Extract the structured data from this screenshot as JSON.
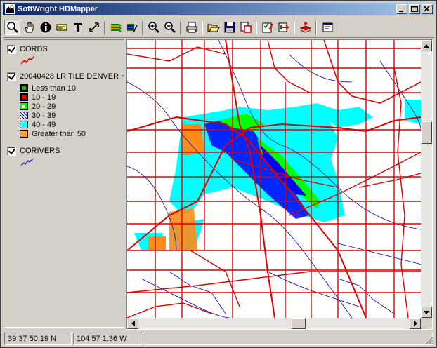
{
  "window": {
    "title": "SoftWright HDMapper",
    "app_icon": "globe-app-icon",
    "controls": [
      "minimize-icon",
      "maximize-icon",
      "close-icon"
    ]
  },
  "toolbar": {
    "buttons": [
      {
        "name": "zoom-tool-icon"
      },
      {
        "name": "pan-hand-icon"
      },
      {
        "name": "info-icon"
      },
      {
        "name": "label-tool-icon"
      },
      {
        "name": "text-tool-icon"
      },
      {
        "name": "measure-arrow-icon"
      },
      {
        "name": "layers-icon"
      },
      {
        "name": "layers-edit-icon"
      },
      {
        "name": "zoom-in-icon"
      },
      {
        "name": "zoom-out-icon"
      },
      {
        "name": "print-icon"
      },
      {
        "name": "open-folder-icon"
      },
      {
        "name": "save-icon"
      },
      {
        "name": "export-icon"
      },
      {
        "name": "checklist-icon"
      },
      {
        "name": "record-icon"
      },
      {
        "name": "add-layer-icon"
      },
      {
        "name": "properties-icon"
      }
    ]
  },
  "legend": {
    "layers": [
      {
        "name": "CORDS",
        "checked": true,
        "symbol_color": "#e00000"
      },
      {
        "name": "20040428 LR TILE DENVER H",
        "checked": true,
        "classes": [
          {
            "label": "Less than 10",
            "fill": "#00c000",
            "border": "#000000"
          },
          {
            "label": "10 - 19",
            "fill": "#ff0000",
            "border": "#000000"
          },
          {
            "label": "20 - 29",
            "fill": "#00ff00",
            "border": "#000000"
          },
          {
            "label": "30 - 39",
            "fill": "#0000ff",
            "border": "#000000"
          },
          {
            "label": "40 - 49",
            "fill": "#00ffff",
            "border": "#000000"
          },
          {
            "label": "Greater than 50",
            "fill": "#ff8c1a",
            "border": "#000000"
          }
        ]
      },
      {
        "name": "CORIVERS",
        "checked": true,
        "symbol_color": "#0000c0"
      }
    ]
  },
  "map": {
    "road_color": "#e00000",
    "river_color": "#0000c0",
    "coverage_colors": {
      "cyan": "#00ffff",
      "green": "#00ff00",
      "blue": "#0000ff",
      "orange": "#ff8c1a"
    }
  },
  "status": {
    "latitude": "39 37 50.19 N",
    "longitude": "104 57 1.36 W"
  }
}
